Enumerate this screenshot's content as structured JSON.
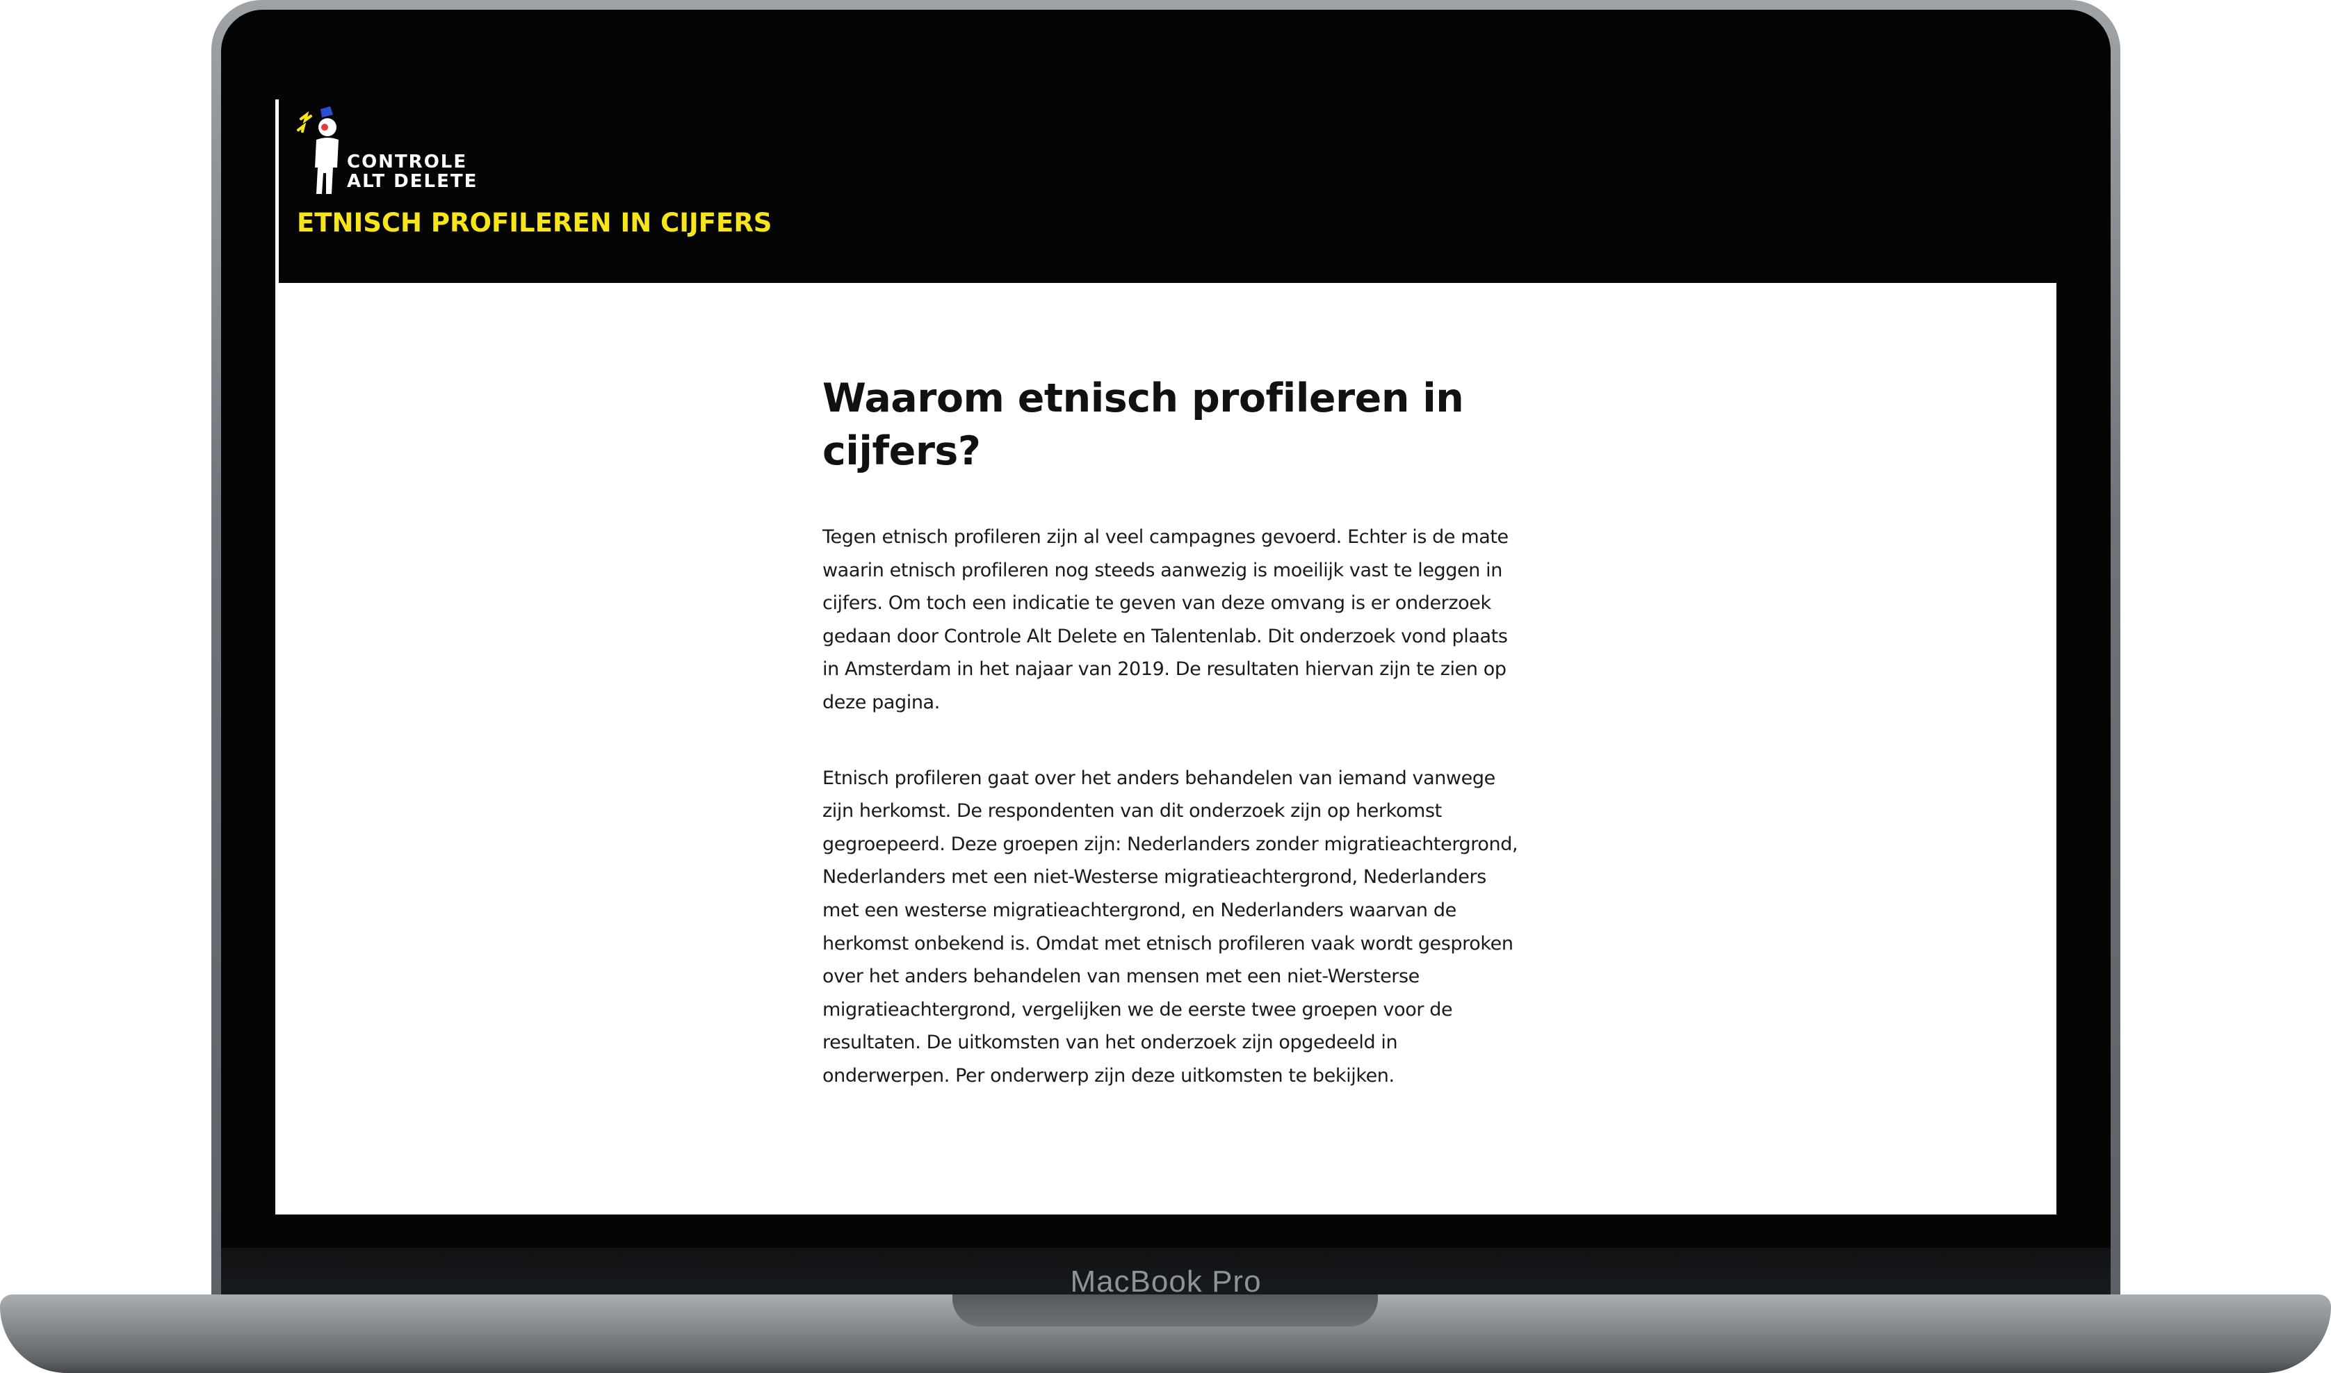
{
  "device": {
    "label": "MacBook Pro"
  },
  "header": {
    "logo": {
      "line1": "CONTROLE",
      "line2": "ALT DELETE"
    },
    "site_title": "ETNISCH PROFILEREN IN CIJFERS"
  },
  "colors": {
    "header_bg": "#050505",
    "accent_yellow": "#f7e51c",
    "logo_blue": "#2a4fd6",
    "page_bg": "#ffffff",
    "text": "#111111"
  },
  "article": {
    "heading": "Waarom etnisch profileren in cijfers?",
    "paragraph1": "Tegen etnisch profileren zijn al veel campagnes gevoerd. Echter is de mate waarin etnisch profileren nog steeds aanwezig is moeilijk vast te leggen in cijfers. Om toch een indicatie te geven van deze omvang is er onderzoek gedaan door Controle Alt Delete en Talentenlab. Dit onderzoek vond plaats in Amsterdam in het najaar van 2019. De resultaten hiervan zijn te zien op deze pagina.",
    "paragraph2": "Etnisch profileren gaat over het anders behandelen van iemand vanwege zijn herkomst. De respondenten van dit onderzoek zijn op herkomst gegroepeerd. Deze groepen zijn: Nederlanders zonder migratieachtergrond, Nederlanders met een niet-Westerse migratieachtergrond, Nederlanders met een westerse migratieachtergrond, en Nederlanders waarvan de herkomst onbekend is. Omdat met etnisch profileren vaak wordt gesproken over het anders behandelen van mensen met een niet-Wersterse migratieachtergrond, vergelijken we de eerste twee groepen voor de resultaten. De uitkomsten van het onderzoek zijn opgedeeld in onderwerpen. Per onderwerp zijn deze uitkomsten te bekijken."
  }
}
